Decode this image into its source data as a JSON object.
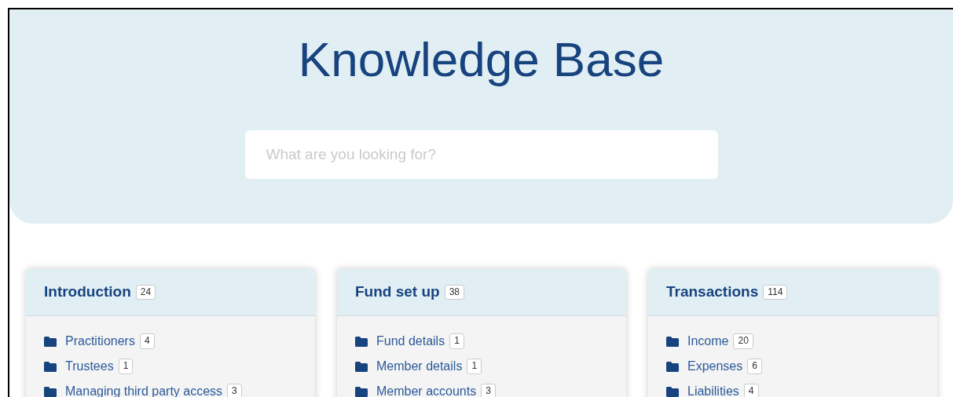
{
  "hero": {
    "title": "Knowledge Base",
    "search": {
      "placeholder": "What are you looking for?"
    }
  },
  "categories": [
    {
      "title": "Introduction",
      "count": "24",
      "items": [
        {
          "label": "Practitioners",
          "count": "4"
        },
        {
          "label": "Trustees",
          "count": "1"
        },
        {
          "label": "Managing third party access",
          "count": "3"
        }
      ]
    },
    {
      "title": "Fund set up",
      "count": "38",
      "items": [
        {
          "label": "Fund details",
          "count": "1"
        },
        {
          "label": "Member details",
          "count": "1"
        },
        {
          "label": "Member accounts",
          "count": "3"
        }
      ]
    },
    {
      "title": "Transactions",
      "count": "114",
      "items": [
        {
          "label": "Income",
          "count": "20"
        },
        {
          "label": "Expenses",
          "count": "6"
        },
        {
          "label": "Liabilities",
          "count": "4"
        }
      ]
    }
  ]
}
